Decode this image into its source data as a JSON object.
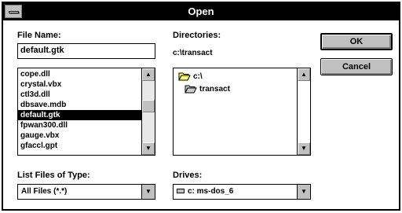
{
  "window": {
    "title": "Open"
  },
  "file_name": {
    "label": "File Name:",
    "value": "default.gtk"
  },
  "file_list": {
    "items": [
      "cope.dll",
      "crystal.vbx",
      "ctl3d.dll",
      "dbsave.mdb",
      "default.gtk",
      "fpwan300.dll",
      "gauge.vbx",
      "gfaccl.gpt"
    ],
    "selected_index": 4
  },
  "directories": {
    "label": "Directories:",
    "current_path": "c:\\transact",
    "items": [
      {
        "label": "c:\\",
        "state": "open"
      },
      {
        "label": "transact",
        "state": "open-current"
      }
    ]
  },
  "buttons": {
    "ok": "OK",
    "cancel": "Cancel"
  },
  "file_type": {
    "label": "List Files of Type:",
    "value": "All Files (*.*)"
  },
  "drives": {
    "label": "Drives:",
    "value": "c: ms-dos_6"
  }
}
